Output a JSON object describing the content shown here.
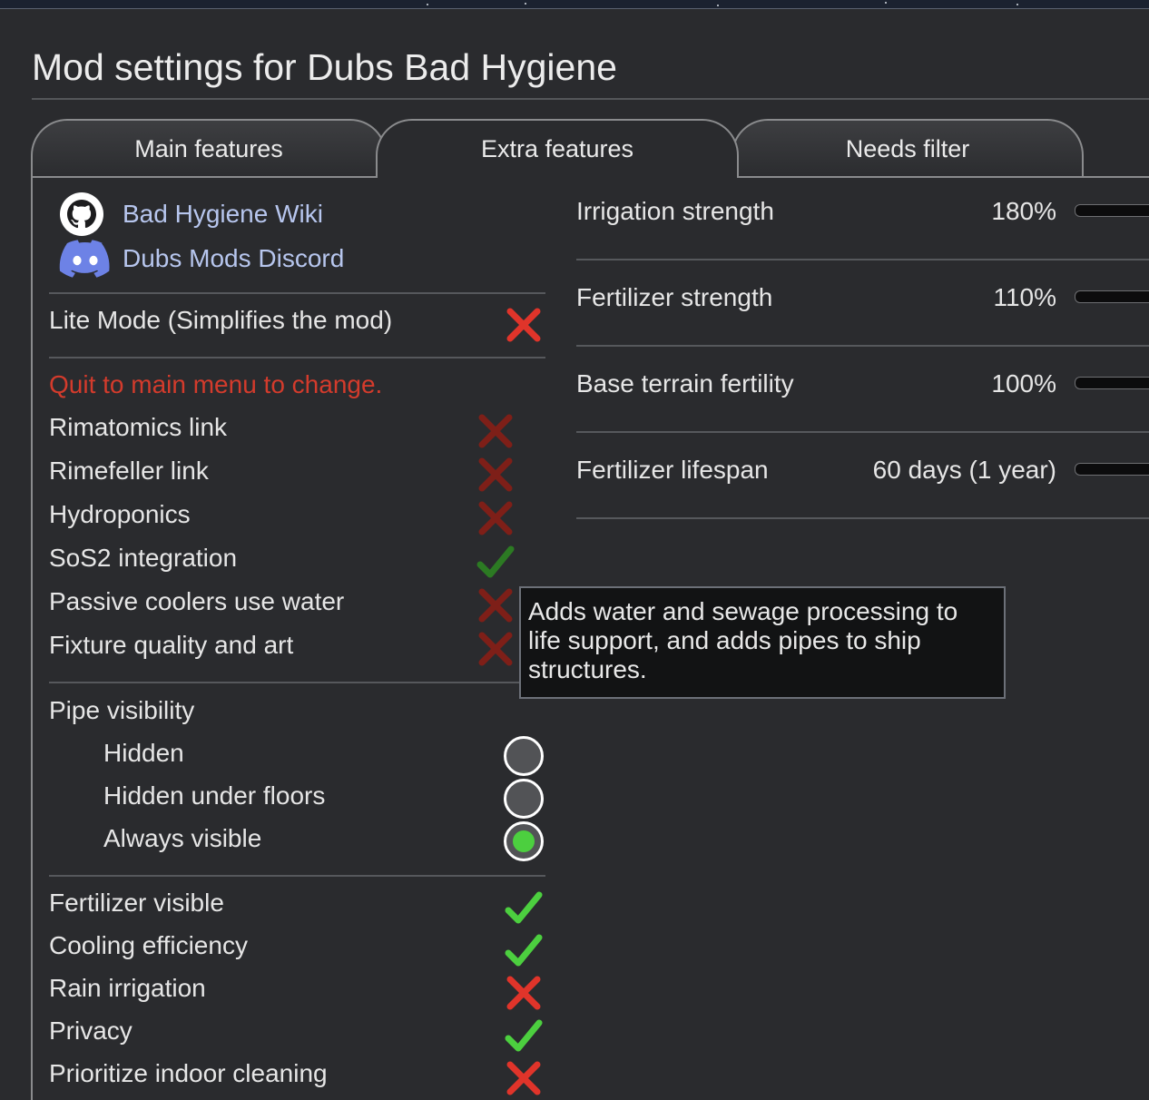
{
  "window": {
    "title": "Mod settings for Dubs Bad Hygiene"
  },
  "tabs": [
    {
      "label": "Main features",
      "active": false
    },
    {
      "label": "Extra features",
      "active": true
    },
    {
      "label": "Needs filter",
      "active": false
    }
  ],
  "links": [
    {
      "label": "Bad Hygiene Wiki",
      "icon": "github-icon"
    },
    {
      "label": "Dubs Mods Discord",
      "icon": "discord-icon"
    }
  ],
  "lite_mode": {
    "label": "Lite Mode (Simplifies the mod)",
    "checked": false
  },
  "warning": "Quit to main menu to change.",
  "integrations": [
    {
      "label": "Rimatomics link",
      "checked": false
    },
    {
      "label": "Rimefeller link",
      "checked": false
    },
    {
      "label": "Hydroponics",
      "checked": false
    },
    {
      "label": "SoS2 integration",
      "checked": true
    },
    {
      "label": "Passive coolers use water",
      "checked": false
    },
    {
      "label": "Fixture quality and art",
      "checked": false
    }
  ],
  "pipe_visibility": {
    "label": "Pipe visibility",
    "options": [
      {
        "label": "Hidden",
        "selected": false
      },
      {
        "label": "Hidden under floors",
        "selected": false
      },
      {
        "label": "Always visible",
        "selected": true
      }
    ]
  },
  "toggles": [
    {
      "label": "Fertilizer visible",
      "checked": true
    },
    {
      "label": "Cooling efficiency",
      "checked": true
    },
    {
      "label": "Rain irrigation",
      "checked": false
    },
    {
      "label": "Privacy",
      "checked": true
    },
    {
      "label": "Prioritize indoor cleaning",
      "checked": false
    }
  ],
  "settings": [
    {
      "label": "Irrigation strength",
      "value": "180%"
    },
    {
      "label": "Fertilizer strength",
      "value": "110%"
    },
    {
      "label": "Base terrain fertility",
      "value": "100%"
    },
    {
      "label": "Fertilizer lifespan",
      "value": "60 days (1 year)"
    }
  ],
  "tooltip": "Adds water and sewage processing to life support, and adds pipes to ship structures.",
  "colors": {
    "accent_link": "#b7c6ee",
    "warning": "#d33b2c",
    "check_green": "#4ccf3f",
    "cross_red": "#e0342a"
  }
}
